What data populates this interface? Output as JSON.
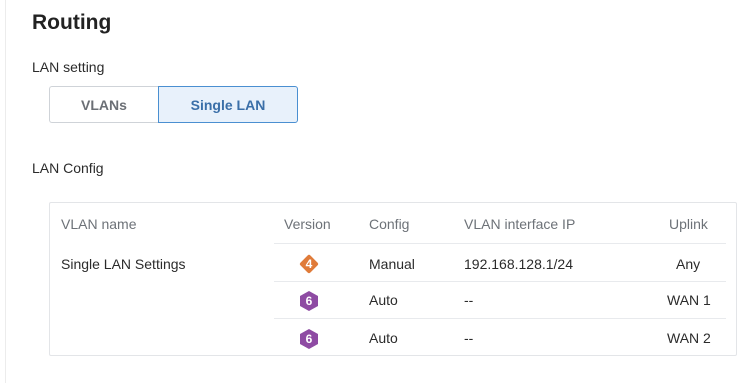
{
  "page": {
    "title": "Routing"
  },
  "lan_setting": {
    "label": "LAN setting",
    "options": [
      "VLANs",
      "Single LAN"
    ],
    "selected": "Single LAN"
  },
  "lan_config": {
    "label": "LAN Config",
    "columns": [
      "VLAN name",
      "Version",
      "Config",
      "VLAN interface IP",
      "Uplink"
    ],
    "rows": [
      {
        "vlan_name": "Single LAN Settings",
        "version": "4",
        "version_icon": "ipv4-diamond-icon",
        "config": "Manual",
        "interface_ip": "192.168.128.1/24",
        "uplink": "Any"
      },
      {
        "vlan_name": "",
        "version": "6",
        "version_icon": "ipv6-hexagon-icon",
        "config": "Auto",
        "interface_ip": "--",
        "uplink": "WAN 1"
      },
      {
        "vlan_name": "",
        "version": "6",
        "version_icon": "ipv6-hexagon-icon",
        "config": "Auto",
        "interface_ip": "--",
        "uplink": "WAN 2"
      }
    ]
  },
  "colors": {
    "ipv4_badge": "#e07b39",
    "ipv6_badge": "#8e4ba3",
    "active_segment_border": "#4a8fd1",
    "active_segment_bg": "#e8f1fb",
    "active_segment_text": "#3a6fa8"
  }
}
